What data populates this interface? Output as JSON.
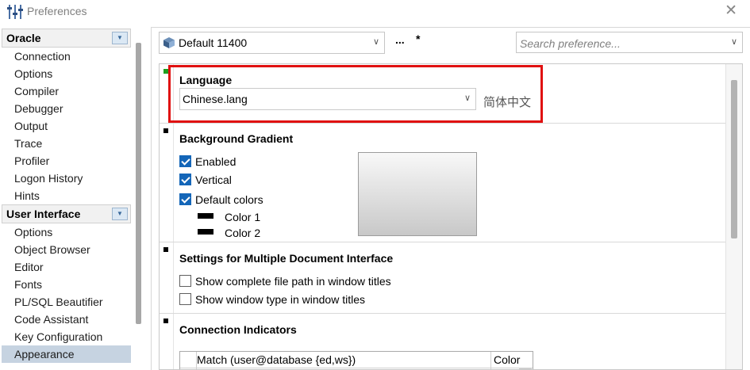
{
  "window": {
    "title": "Preferences",
    "icon": "sliders-icon",
    "close_glyph": "✕"
  },
  "sidebar": {
    "categories": [
      {
        "label": "Oracle",
        "items": [
          "Connection",
          "Options",
          "Compiler",
          "Debugger",
          "Output",
          "Trace",
          "Profiler",
          "Logon History",
          "Hints"
        ]
      },
      {
        "label": "User Interface",
        "items": [
          "Options",
          "Object Browser",
          "Editor",
          "Fonts",
          "PL/SQL Beautifier",
          "Code Assistant",
          "Key Configuration",
          "Appearance"
        ],
        "selected": "Appearance"
      }
    ]
  },
  "toolbar": {
    "profile_value": "Default 11400",
    "dots_label": "...",
    "modified_mark": "*",
    "search_placeholder": "Search preference..."
  },
  "language": {
    "title": "Language",
    "value": "Chinese.lang",
    "native_name": "简体中文"
  },
  "background_gradient": {
    "title": "Background Gradient",
    "enabled_label": "Enabled",
    "enabled": true,
    "vertical_label": "Vertical",
    "vertical": true,
    "default_colors_label": "Default colors",
    "default_colors": true,
    "color1_label": "Color 1",
    "color2_label": "Color 2"
  },
  "mdi": {
    "title": "Settings for Multiple Document Interface",
    "show_path_label": "Show complete file path in window titles",
    "show_path": false,
    "show_type_label": "Show window type in window titles",
    "show_type": false
  },
  "connection_indicators": {
    "title": "Connection Indicators",
    "columns": [
      "Match (user@database {ed,ws})",
      "Color"
    ],
    "new_row_marker": "*",
    "ellipsis": "..."
  },
  "colors": {
    "highlight": "#e01010",
    "checkbox": "#1466b8",
    "selected_item": "#c6d3e1"
  }
}
